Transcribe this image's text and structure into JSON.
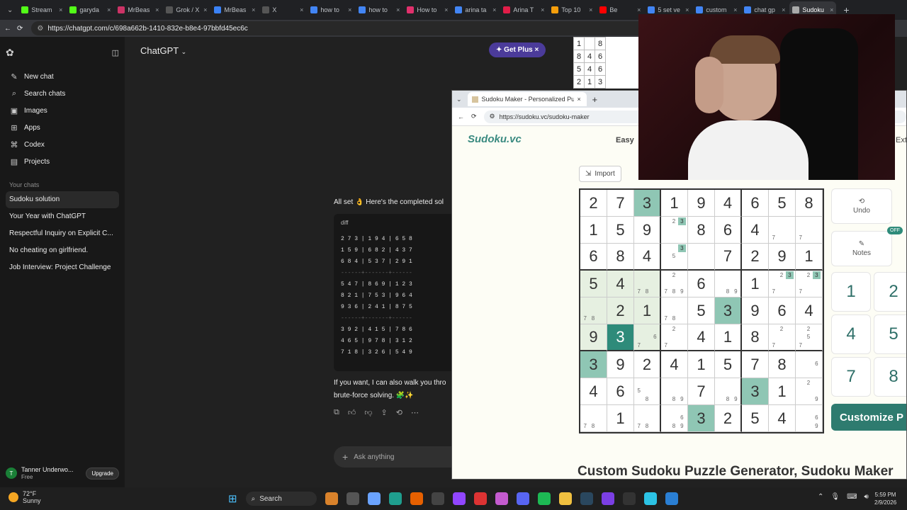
{
  "browser": {
    "tabs": [
      {
        "label": "Stream",
        "color": "#53fc18"
      },
      {
        "label": "garyda",
        "color": "#53fc18"
      },
      {
        "label": "MrBeas",
        "color": "#cc3366"
      },
      {
        "label": "Grok / X",
        "color": "#555555"
      },
      {
        "label": "MrBeas",
        "color": "#3b82f6"
      },
      {
        "label": "X",
        "color": "#555555"
      },
      {
        "label": "how to",
        "color": "#4285f4"
      },
      {
        "label": "how to",
        "color": "#4285f4"
      },
      {
        "label": "How to",
        "color": "#e1306c"
      },
      {
        "label": "arina ta",
        "color": "#4285f4"
      },
      {
        "label": "Arina T",
        "color": "#e11d48"
      },
      {
        "label": "Top 10",
        "color": "#f59e0b"
      },
      {
        "label": "Be",
        "color": "#ff0000"
      },
      {
        "label": "5 set ve",
        "color": "#4285f4"
      },
      {
        "label": "custom",
        "color": "#4285f4"
      },
      {
        "label": "chat gp",
        "color": "#4285f4"
      },
      {
        "label": "Sudoku",
        "color": "#aaaaaa"
      }
    ],
    "url": "https://chatgpt.com/c/698a662b-1410-832e-b8e4-97bbfd45ec6c"
  },
  "sidebar": {
    "nav": [
      {
        "label": "New chat",
        "icon": "✎"
      },
      {
        "label": "Search chats",
        "icon": "⌕"
      },
      {
        "label": "Images",
        "icon": "▣"
      },
      {
        "label": "Apps",
        "icon": "⊞"
      },
      {
        "label": "Codex",
        "icon": "⌘"
      },
      {
        "label": "Projects",
        "icon": "▤"
      }
    ],
    "section_label": "Your chats",
    "chats": [
      "Sudoku solution",
      "Your Year with ChatGPT",
      "Respectful Inquiry on Explicit C...",
      "No cheating on girlfriend.",
      "Job Interview: Project Challenge"
    ],
    "user": {
      "initial": "T",
      "name": "Tanner Underwo...",
      "plan": "Free",
      "upgrade": "Upgrade"
    }
  },
  "main": {
    "title": "ChatGPT",
    "get_plus": "Get Plus",
    "reply_head": "All set 👌 Here's the completed sol",
    "code_lang": "diff",
    "code_lines": [
      "2 7 3 | 1 9 4 | 6 5 8",
      "1 5 9 | 6 8 2 | 4 3 7",
      "6 8 4 | 5 3 7 | 2 9 1",
      "------+-------+------",
      "5 4 7 | 8 6 9 | 1 2 3",
      "8 2 1 | 7 5 3 | 9 6 4",
      "9 3 6 | 2 4 1 | 8 7 5",
      "------+-------+------",
      "3 9 2 | 4 1 5 | 7 8 6",
      "4 6 5 | 9 7 8 | 3 1 2",
      "7 1 8 | 3 2 6 | 5 4 9"
    ],
    "reply_tail_1": "If you want, I can also walk you thro",
    "reply_tail_2": "brute-force solving. 🧩✨",
    "ask_placeholder": "Ask anything"
  },
  "thumbnail": {
    "rows": [
      [
        "1",
        "",
        "8"
      ],
      [
        "8",
        "4",
        "6"
      ],
      [
        "5",
        "4",
        "6"
      ],
      [
        "2",
        "1",
        "3"
      ]
    ]
  },
  "popup": {
    "tab_title": "Sudoku Maker - Personalized Puzz",
    "url": "https://sudoku.vc/sudoku-maker",
    "logo": "Sudoku.vc",
    "difficulty": "Easy",
    "difficulty_next": "Ext",
    "import_label": "Import",
    "undo_label": "Undo",
    "notes_label": "Notes",
    "notes_state": "OFF",
    "numpad": [
      "1",
      "2",
      "4",
      "5",
      "7",
      "8"
    ],
    "customize_label": "Customize P",
    "site_title": "Custom Sudoku Puzzle Generator, Sudoku Maker",
    "board": [
      [
        {
          "v": "2"
        },
        {
          "v": "7"
        },
        {
          "v": "3",
          "s": "teal"
        },
        {
          "v": "1"
        },
        {
          "v": "9"
        },
        {
          "v": "4"
        },
        {
          "v": "6"
        },
        {
          "v": "5"
        },
        {
          "v": "8"
        }
      ],
      [
        {
          "v": "1"
        },
        {
          "v": "5"
        },
        {
          "v": "9"
        },
        {
          "n": [
            "",
            "2",
            "3h",
            "",
            "",
            "",
            "",
            "",
            ""
          ]
        },
        {
          "v": "8"
        },
        {
          "v": "6"
        },
        {
          "v": "4"
        },
        {
          "n": [
            "",
            "",
            "",
            "",
            "",
            "",
            "7",
            "",
            ""
          ]
        },
        {
          "n": [
            "",
            "",
            "",
            "",
            "",
            "",
            "7",
            "",
            ""
          ]
        }
      ],
      [
        {
          "v": "6"
        },
        {
          "v": "8"
        },
        {
          "v": "4"
        },
        {
          "n": [
            "",
            "",
            "3h",
            "",
            "5",
            "",
            "",
            "",
            ""
          ]
        },
        {
          "v": ""
        },
        {
          "v": "7"
        },
        {
          "v": "2"
        },
        {
          "v": "9"
        },
        {
          "v": "1"
        }
      ],
      [
        {
          "v": "5",
          "s": "hl"
        },
        {
          "v": "4",
          "s": "hl"
        },
        {
          "n": [
            "",
            "",
            "",
            "",
            "",
            "",
            "7",
            "8",
            ""
          ],
          "s": "hl"
        },
        {
          "n": [
            "",
            "2",
            "",
            "",
            "",
            "",
            "7",
            "8",
            "9"
          ]
        },
        {
          "v": "6"
        },
        {
          "n": [
            "",
            "",
            "",
            "",
            "",
            "",
            "",
            "8",
            "9"
          ]
        },
        {
          "v": "1"
        },
        {
          "n": [
            "",
            "2",
            "3h",
            "",
            "",
            "",
            "7",
            "",
            ""
          ]
        },
        {
          "n": [
            "",
            "2",
            "3h",
            "",
            "",
            "",
            "7",
            "",
            ""
          ]
        }
      ],
      [
        {
          "n": [
            "",
            "",
            "",
            "",
            "",
            "",
            "7",
            "8",
            ""
          ],
          "s": "hl"
        },
        {
          "v": "2",
          "s": "hl"
        },
        {
          "v": "1",
          "s": "hl"
        },
        {
          "n": [
            "",
            "",
            "",
            "",
            "",
            "",
            "7",
            "8",
            ""
          ]
        },
        {
          "v": "5"
        },
        {
          "v": "3",
          "s": "teal"
        },
        {
          "v": "9"
        },
        {
          "v": "6"
        },
        {
          "v": "4"
        }
      ],
      [
        {
          "v": "9",
          "s": "hl"
        },
        {
          "v": "3",
          "s": "dark"
        },
        {
          "n": [
            "",
            "",
            "",
            "",
            "",
            "6",
            "7",
            "",
            ""
          ],
          "s": "hl"
        },
        {
          "n": [
            "",
            "2",
            "",
            "",
            "",
            "",
            "7",
            "",
            ""
          ]
        },
        {
          "v": "4"
        },
        {
          "v": "1"
        },
        {
          "v": "8"
        },
        {
          "n": [
            "",
            "2",
            "",
            "",
            "",
            "",
            "7",
            "",
            ""
          ]
        },
        {
          "n": [
            "",
            "2",
            "",
            "",
            "5",
            "",
            "7",
            "",
            ""
          ]
        }
      ],
      [
        {
          "v": "3",
          "s": "teal"
        },
        {
          "v": "9"
        },
        {
          "v": "2"
        },
        {
          "v": "4"
        },
        {
          "v": "1"
        },
        {
          "v": "5"
        },
        {
          "v": "7"
        },
        {
          "v": "8"
        },
        {
          "n": [
            "",
            "",
            "",
            "",
            "",
            "6",
            "",
            "",
            ""
          ]
        }
      ],
      [
        {
          "v": "4"
        },
        {
          "v": "6"
        },
        {
          "n": [
            "",
            "",
            "",
            "5",
            "",
            "",
            "",
            "8",
            ""
          ]
        },
        {
          "n": [
            "",
            "",
            "",
            "",
            "",
            "",
            "",
            "8",
            "9"
          ]
        },
        {
          "v": "7"
        },
        {
          "n": [
            "",
            "",
            "",
            "",
            "",
            "",
            "",
            "8",
            "9"
          ]
        },
        {
          "v": "3",
          "s": "teal"
        },
        {
          "v": "1"
        },
        {
          "n": [
            "",
            "2",
            "",
            "",
            "",
            "",
            "",
            "",
            "9"
          ]
        }
      ],
      [
        {
          "n": [
            "",
            "",
            "",
            "",
            "",
            "",
            "7",
            "8",
            ""
          ]
        },
        {
          "v": "1"
        },
        {
          "n": [
            "",
            "",
            "",
            "",
            "",
            "",
            "7",
            "8",
            ""
          ]
        },
        {
          "n": [
            "",
            "",
            "",
            "",
            "",
            "6",
            "",
            "8",
            "9"
          ]
        },
        {
          "v": "3",
          "s": "teal"
        },
        {
          "v": "2"
        },
        {
          "v": "5"
        },
        {
          "v": "4"
        },
        {
          "n": [
            "",
            "",
            "",
            "",
            "",
            "6",
            "",
            "",
            "9"
          ]
        }
      ]
    ]
  },
  "taskbar": {
    "temp": "72°F",
    "condition": "Sunny",
    "search": "Search",
    "time": "5:59 PM",
    "date": "2/9/2026"
  }
}
